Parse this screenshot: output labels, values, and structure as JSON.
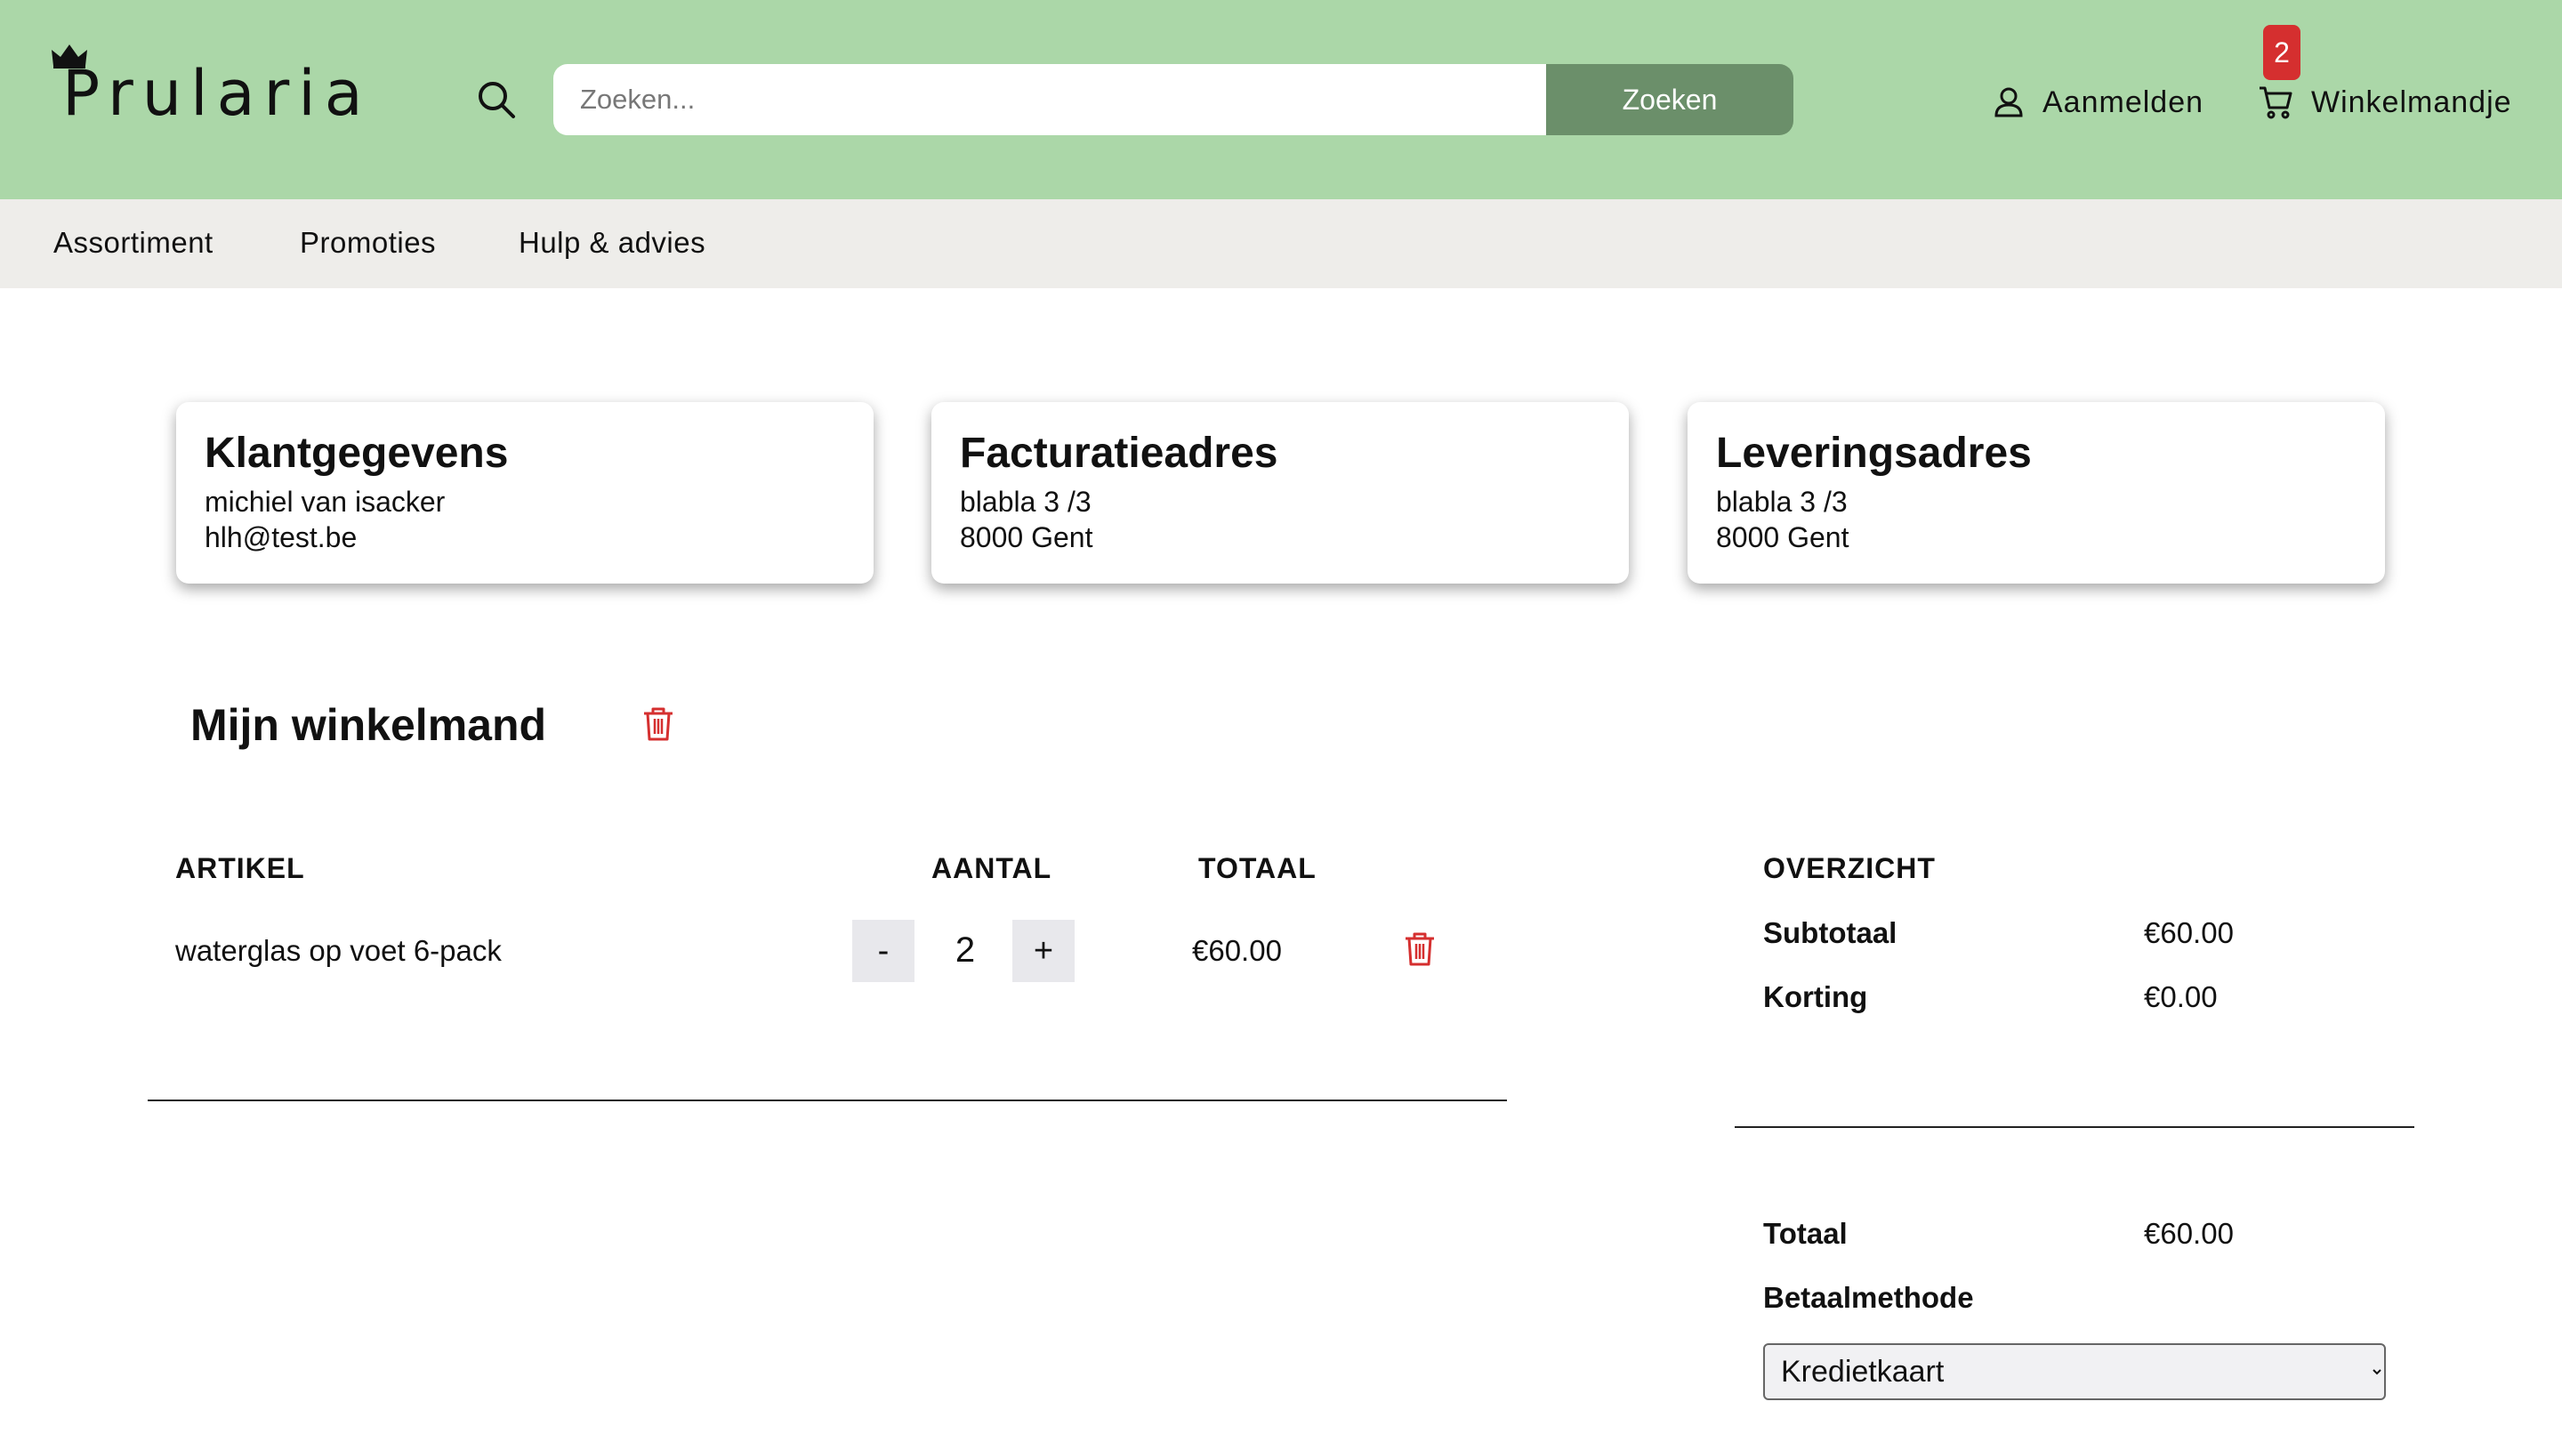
{
  "header": {
    "brand": "Prularia",
    "search": {
      "placeholder": "Zoeken...",
      "button_label": "Zoeken"
    },
    "login_label": "Aanmelden",
    "cart_label": "Winkelmandje",
    "cart_count": "2",
    "background_color": "#abd7a8",
    "button_color": "#6b8f6a"
  },
  "nav": {
    "items": [
      {
        "label": "Assortiment"
      },
      {
        "label": "Promoties"
      },
      {
        "label": "Hulp & advies"
      }
    ]
  },
  "cards": [
    {
      "title": "Klantgegevens",
      "lines": [
        "michiel van isacker",
        "hlh@test.be"
      ]
    },
    {
      "title": "Facturatieadres",
      "lines": [
        "blabla 3 /3",
        "8000 Gent"
      ]
    },
    {
      "title": "Leveringsadres",
      "lines": [
        "blabla 3 /3",
        "8000 Gent"
      ]
    }
  ],
  "cart": {
    "title": "Mijn winkelmand",
    "columns": {
      "article": "ARTIKEL",
      "quantity": "AANTAL",
      "total": "TOTAAL"
    },
    "items": [
      {
        "name": "waterglas op voet 6-pack",
        "quantity": "2",
        "total": "€60.00",
        "minus_label": "-",
        "plus_label": "+"
      }
    ]
  },
  "overview": {
    "title": "OVERZICHT",
    "subtotal_label": "Subtotaal",
    "subtotal_value": "€60.00",
    "discount_label": "Korting",
    "discount_value": "€0.00",
    "total_label": "Totaal",
    "total_value": "€60.00",
    "payment_label": "Betaalmethode",
    "payment_selected": "Kredietkaart"
  },
  "icons": {
    "search": "search-icon",
    "user": "user-icon",
    "cart": "cart-icon",
    "trash": "trash-icon",
    "crown": "crown-icon",
    "trash_color": "#d52f2f"
  }
}
